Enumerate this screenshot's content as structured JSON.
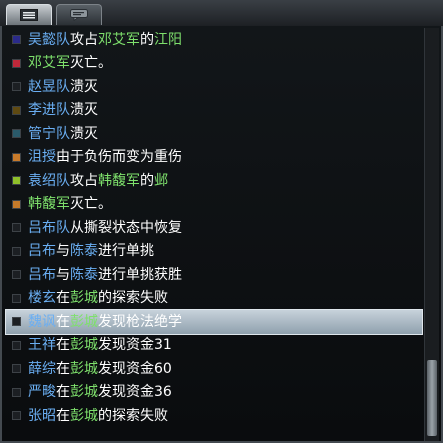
{
  "tabs": [
    {
      "icon": "list-icon",
      "active": true
    },
    {
      "icon": "chat-icon",
      "active": false
    }
  ],
  "colors": {
    "actor": "#6aaef2",
    "place": "#7ee06c",
    "text": "#ffffff",
    "selected_bg": "#aebcc7"
  },
  "log": [
    {
      "marker": "#2b2b8a",
      "parts": [
        [
          "吴懿队",
          "blue"
        ],
        [
          "攻占",
          "white"
        ],
        [
          "邓艾军",
          "green"
        ],
        [
          "的",
          "white"
        ],
        [
          "江阳",
          "green"
        ]
      ]
    },
    {
      "marker": "#c0283a",
      "parts": [
        [
          "邓艾军",
          "green"
        ],
        [
          "灭亡。",
          "white"
        ]
      ]
    },
    {
      "marker": "#1c1f23",
      "parts": [
        [
          "赵昱队",
          "blue"
        ],
        [
          "溃灭",
          "white"
        ]
      ]
    },
    {
      "marker": "#5f4a12",
      "parts": [
        [
          "李进队",
          "blue"
        ],
        [
          "溃灭",
          "white"
        ]
      ]
    },
    {
      "marker": "#2a5a6a",
      "parts": [
        [
          "管宁队",
          "blue"
        ],
        [
          "溃灭",
          "white"
        ]
      ]
    },
    {
      "marker": "#c87a2a",
      "parts": [
        [
          "沮授",
          "blue"
        ],
        [
          "由于负伤而变为重伤",
          "white"
        ]
      ]
    },
    {
      "marker": "#8fbf2a",
      "parts": [
        [
          "袁绍队",
          "blue"
        ],
        [
          "攻占",
          "white"
        ],
        [
          "韩馥军",
          "green"
        ],
        [
          "的",
          "white"
        ],
        [
          "邺",
          "green"
        ]
      ]
    },
    {
      "marker": "#c47a2a",
      "parts": [
        [
          "韩馥军",
          "green"
        ],
        [
          "灭亡。",
          "white"
        ]
      ]
    },
    {
      "marker": "#1c1f23",
      "parts": [
        [
          "吕布队",
          "blue"
        ],
        [
          "从撕裂状态中恢复",
          "white"
        ]
      ]
    },
    {
      "marker": "#1c1f23",
      "parts": [
        [
          "吕布",
          "blue"
        ],
        [
          "与",
          "white"
        ],
        [
          "陈泰",
          "blue"
        ],
        [
          "进行单挑",
          "white"
        ]
      ]
    },
    {
      "marker": "#1c1f23",
      "parts": [
        [
          "吕布",
          "blue"
        ],
        [
          "与",
          "white"
        ],
        [
          "陈泰",
          "blue"
        ],
        [
          "进行单挑获胜",
          "white"
        ]
      ]
    },
    {
      "marker": "#1c1f23",
      "parts": [
        [
          "楼玄",
          "blue"
        ],
        [
          "在",
          "white"
        ],
        [
          "彭城",
          "green"
        ],
        [
          "的探索失败",
          "white"
        ]
      ]
    },
    {
      "marker": "#1c1f23",
      "selected": true,
      "parts": [
        [
          "魏讽",
          "blue"
        ],
        [
          "在",
          "white"
        ],
        [
          "彭城",
          "green"
        ],
        [
          "发现枪法绝学",
          "white"
        ]
      ]
    },
    {
      "marker": "#1c1f23",
      "parts": [
        [
          "王祥",
          "blue"
        ],
        [
          "在",
          "white"
        ],
        [
          "彭城",
          "green"
        ],
        [
          "发现资金31",
          "white"
        ]
      ]
    },
    {
      "marker": "#1c1f23",
      "parts": [
        [
          "薛综",
          "blue"
        ],
        [
          "在",
          "white"
        ],
        [
          "彭城",
          "green"
        ],
        [
          "发现资金60",
          "white"
        ]
      ]
    },
    {
      "marker": "#1c1f23",
      "parts": [
        [
          "严畯",
          "blue"
        ],
        [
          "在",
          "white"
        ],
        [
          "彭城",
          "green"
        ],
        [
          "发现资金36",
          "white"
        ]
      ]
    },
    {
      "marker": "#1c1f23",
      "parts": [
        [
          "张昭",
          "blue"
        ],
        [
          "在",
          "white"
        ],
        [
          "彭城",
          "green"
        ],
        [
          "的探索失败",
          "white"
        ]
      ]
    }
  ]
}
